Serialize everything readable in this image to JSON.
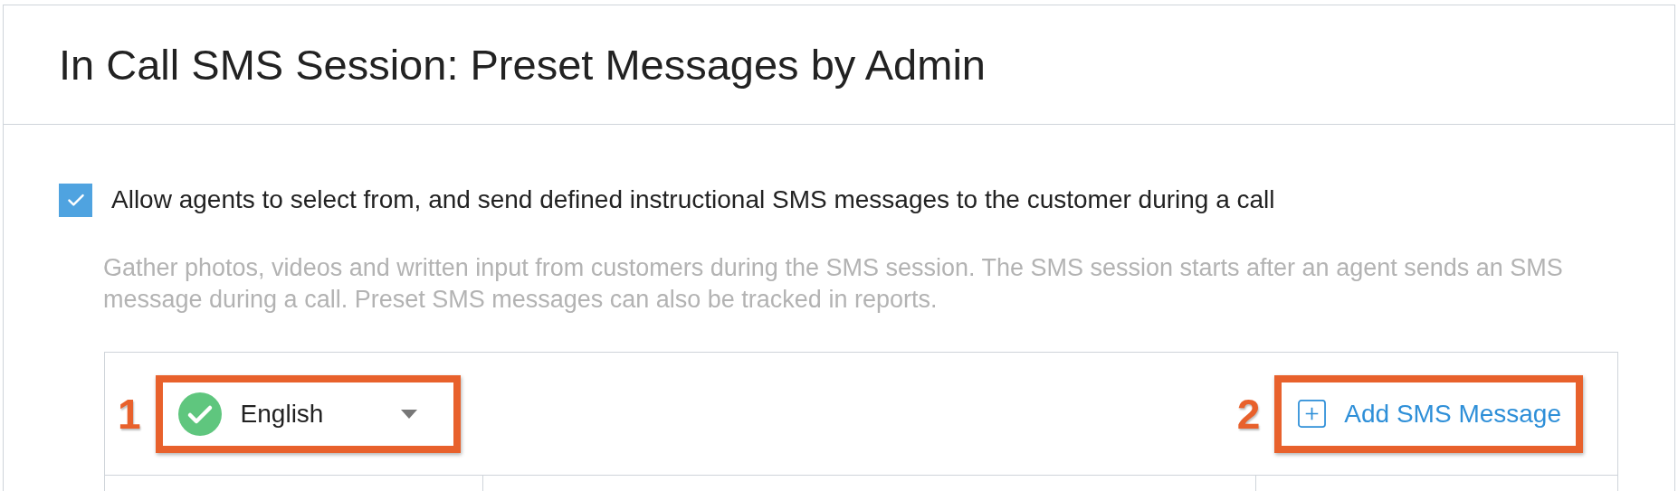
{
  "header": {
    "title": "In Call SMS Session: Preset Messages by Admin"
  },
  "setting": {
    "checked": true,
    "label": "Allow agents to select from, and send defined instructional SMS messages to the customer during a call",
    "description": "Gather photos, videos and written input from customers during the SMS session. The SMS session starts after an agent sends an SMS message during a call. Preset SMS messages can also be tracked in reports."
  },
  "language_dropdown": {
    "value": "English"
  },
  "add_button": {
    "label": "Add SMS Message"
  },
  "callouts": [
    {
      "number": "1"
    },
    {
      "number": "2"
    }
  ]
}
